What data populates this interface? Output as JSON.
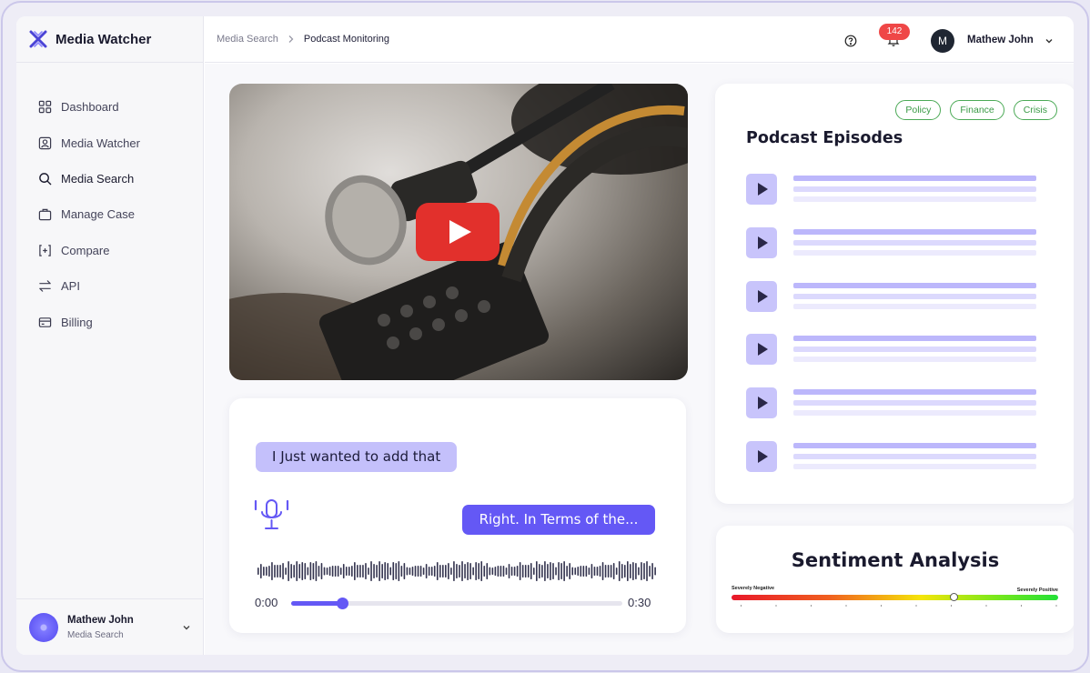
{
  "app": {
    "title": "Media Watcher"
  },
  "sidebar": {
    "items": [
      {
        "label": "Dashboard",
        "icon": "grid-icon",
        "active": false
      },
      {
        "label": "Media Watcher",
        "icon": "user-square-icon",
        "active": false
      },
      {
        "label": "Media Search",
        "icon": "search-icon",
        "active": true
      },
      {
        "label": "Manage Case",
        "icon": "briefcase-icon",
        "active": false
      },
      {
        "label": "Compare",
        "icon": "compare-icon",
        "active": false
      },
      {
        "label": "API",
        "icon": "arrows-swap-icon",
        "active": false
      },
      {
        "label": "Billing",
        "icon": "card-icon",
        "active": false
      }
    ],
    "user": {
      "name": "Mathew John",
      "role": "Media Search"
    }
  },
  "header": {
    "breadcrumb": [
      "Media Search",
      "Podcast Monitoring"
    ],
    "notifications": "142",
    "user": {
      "initial": "M",
      "name": "Mathew John"
    }
  },
  "transcript": {
    "message_1": "I Just wanted to add that",
    "message_2": "Right. In Terms of the...",
    "time_start": "0:00",
    "time_end": "0:30",
    "progress": 0.155
  },
  "episodes": {
    "title": "Podcast Episodes",
    "tags": [
      "Policy",
      "Finance",
      "Crisis"
    ],
    "count": 6
  },
  "sentiment": {
    "title": "Sentiment Analysis",
    "label_negative": "Severely Negative",
    "label_positive": "Severely Positive",
    "value": 0.68
  },
  "colors": {
    "accent": "#6458f5",
    "accent_light": "#c4c0fb",
    "tag_green": "#4caa57",
    "badge_red": "#ef4747",
    "play_red": "#e2302c"
  }
}
